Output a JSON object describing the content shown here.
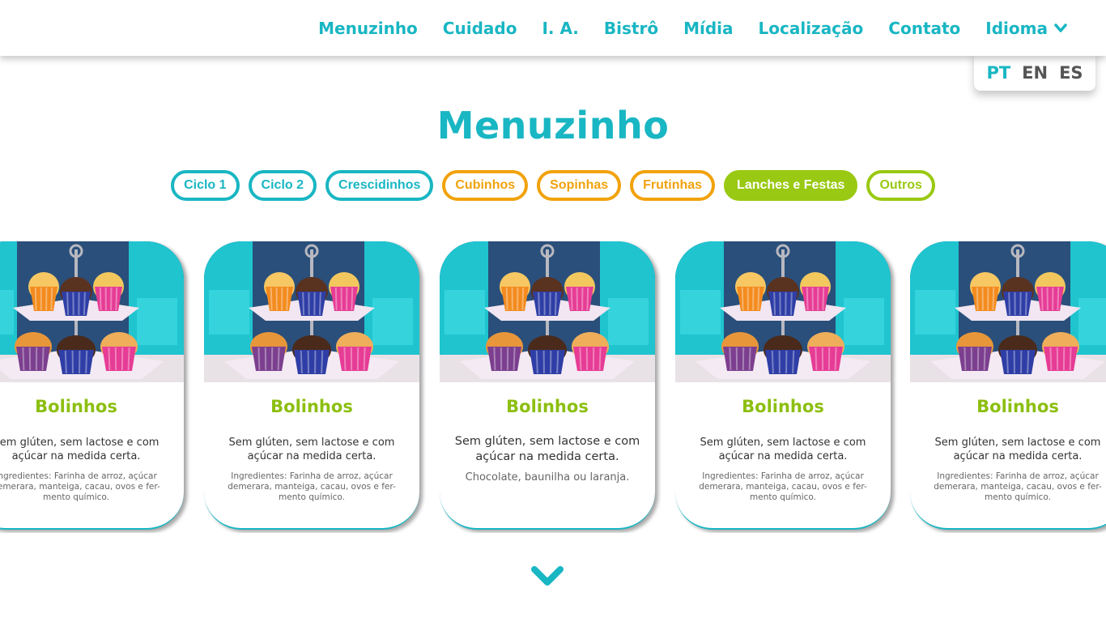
{
  "nav": {
    "items": [
      "Menuzinho",
      "Cuidado",
      "I. A.",
      "Bistrô",
      "Mídia",
      "Localização",
      "Contato",
      "Idioma"
    ],
    "languages": [
      "PT",
      "EN",
      "ES"
    ],
    "active_language": "PT"
  },
  "page": {
    "title": "Menuzinho"
  },
  "filters": [
    {
      "label": "Ciclo 1",
      "color": "#19b6c3",
      "active": false
    },
    {
      "label": "Ciclo 2",
      "color": "#19b6c3",
      "active": false
    },
    {
      "label": "Crescidinhos",
      "color": "#19b6c3",
      "active": false
    },
    {
      "label": "Cubinhos",
      "color": "#f1a20c",
      "active": false
    },
    {
      "label": "Sopinhas",
      "color": "#f1a20c",
      "active": false
    },
    {
      "label": "Frutinhas",
      "color": "#f1a20c",
      "active": false
    },
    {
      "label": "Lanches e Festas",
      "color": "#99c912",
      "active": true
    },
    {
      "label": "Outros",
      "color": "#99c912",
      "active": false
    }
  ],
  "cards": [
    {
      "name": "Bolinhos",
      "description": "Sem glúten, sem lactose e com açúcar na medida certa.",
      "ingredients": "Ingredientes: Farinha de arroz, açúcar demerara, manteiga, cacau, ovos e fer-mento químico.",
      "image": "cupcakes-stand-photo"
    },
    {
      "name": "Bolinhos",
      "description": "Sem glúten, sem lactose e com açúcar na medida certa.",
      "ingredients": "Ingredientes: Farinha de arroz, açúcar demerara, manteiga, cacau, ovos e fer-mento químico.",
      "image": "cupcakes-stand-photo"
    },
    {
      "name": "Bolinhos",
      "description": "Sem glúten, sem lactose e com açúcar na medida certa.",
      "ingredients": "Chocolate, baunilha ou laranja.",
      "image": "cupcakes-stand-photo"
    },
    {
      "name": "Bolinhos",
      "description": "Sem glúten, sem lactose e com açúcar na medida certa.",
      "ingredients": "Ingredientes: Farinha de arroz, açúcar demerara, manteiga, cacau, ovos e fer-mento químico.",
      "image": "cupcakes-stand-photo"
    },
    {
      "name": "Bolinhos",
      "description": "Sem glúten, sem lactose e com açúcar na medida certa.",
      "ingredients": "Ingredientes: Farinha de arroz, açúcar demerara, manteiga, cacau, ovos e fer-mento químico.",
      "image": "cupcakes-stand-photo"
    }
  ],
  "colors": {
    "teal": "#19b6c3",
    "orange": "#f1a20c",
    "green": "#99c912",
    "card_title": "#8cbf10"
  },
  "icons": {
    "dropdown": "chevron-down-icon",
    "scroll": "chevron-down-icon"
  }
}
